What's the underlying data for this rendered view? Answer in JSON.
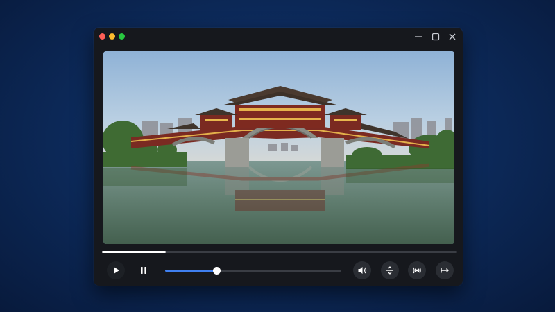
{
  "window": {
    "controls": [
      "minimize-icon",
      "maximize-icon",
      "close-icon"
    ],
    "traffic_lights": [
      "#ff5f57",
      "#febc2e",
      "#28c840"
    ]
  },
  "video": {
    "scene": "bridge-photo",
    "timeline_progress": 0.18
  },
  "controls": {
    "play_icon": "play-icon",
    "pause_icon": "pause-icon",
    "seek_fraction": 0.29,
    "seek_color": "#3f7ff0",
    "right_icons": [
      "volume-icon",
      "split-horizontal-icon",
      "broadcast-icon",
      "expand-horizontal-icon"
    ]
  }
}
